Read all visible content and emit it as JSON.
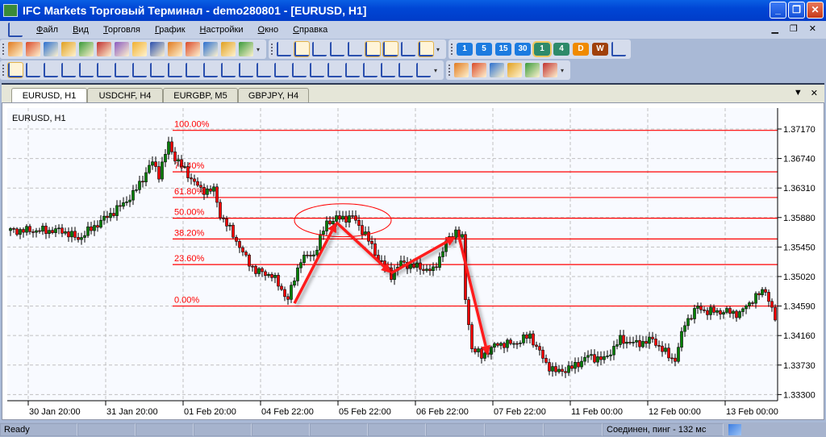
{
  "window": {
    "title": "IFC Markets Торговый Терминал - demo280801 - [EURUSD, H1]",
    "logo": "IFC"
  },
  "menu": [
    "Файл",
    "Вид",
    "Торговля",
    "График",
    "Настройки",
    "Окно",
    "Справка"
  ],
  "toolbar1": {
    "standard": [
      "new-order",
      "open-chart",
      "market-watch",
      "navigator",
      "terminal",
      "data-window",
      "expert-advisors",
      "strategy-tester",
      "history",
      "export",
      "alerts",
      "reports",
      "open-folder",
      "save-folder"
    ],
    "chart": [
      "bar-chart",
      "candlesticks",
      "line-chart",
      "zoom-in",
      "zoom-out",
      "auto-scroll",
      "chart-shift",
      "indicators",
      "grid"
    ],
    "timeframes": [
      {
        "label": "1",
        "color": "#1c7be0"
      },
      {
        "label": "5",
        "color": "#1c7be0"
      },
      {
        "label": "15",
        "color": "#1c7be0"
      },
      {
        "label": "30",
        "color": "#1c7be0"
      },
      {
        "label": "1",
        "color": "#2e8a6a",
        "active": true
      },
      {
        "label": "4",
        "color": "#2e8a6a"
      },
      {
        "label": "D",
        "color": "#f08a00"
      },
      {
        "label": "W",
        "color": "#a0400a"
      }
    ]
  },
  "toolbar2": {
    "drawing": [
      "cursor",
      "crosshair",
      "object",
      "trendline",
      "angle-line",
      "horizontal-line",
      "vertical-line",
      "pencil",
      "channel",
      "andrews-pitchfork",
      "gann-fan",
      "equidistant-channel",
      "fibo-retracement",
      "fibo-expansion",
      "fibo-arcs",
      "fibo-fan",
      "fibo-timezones",
      "fibo-channel",
      "regression",
      "rectangle",
      "triangle",
      "ellipse",
      "text",
      "text-label"
    ],
    "other": [
      "indicators-list",
      "alert-add",
      "alert-disabled",
      "options",
      "news",
      "help"
    ]
  },
  "tabs": [
    {
      "label": "EURUSD, H1",
      "active": true
    },
    {
      "label": "USDCHF, H4"
    },
    {
      "label": "EURGBP, M5"
    },
    {
      "label": "GBPJPY, H4"
    }
  ],
  "status": {
    "ready": "Ready",
    "connection": "Соединен, пинг - 132 мс"
  },
  "chart_data": {
    "type": "candlestick",
    "title": "EURUSD, H1",
    "ylim": [
      1.333,
      1.3717
    ],
    "y_ticks": [
      "1.37170",
      "1.36740",
      "1.36310",
      "1.35880",
      "1.35450",
      "1.35020",
      "1.34590",
      "1.34160",
      "1.33730",
      "1.33300"
    ],
    "x_ticks": [
      "30 Jan 20:00",
      "31 Jan 20:00",
      "01 Feb 20:00",
      "04 Feb 22:00",
      "05 Feb 22:00",
      "06 Feb 22:00",
      "07 Feb 22:00",
      "11 Feb 00:00",
      "12 Feb 00:00",
      "13 Feb 00:00"
    ],
    "bars": 238,
    "price_path": [
      [
        0,
        1.3569
      ],
      [
        17,
        1.3569
      ],
      [
        22,
        1.3557
      ],
      [
        30,
        1.3586
      ],
      [
        35,
        1.3604
      ],
      [
        39,
        1.3622
      ],
      [
        45,
        1.3669
      ],
      [
        47,
        1.3651
      ],
      [
        50,
        1.3695
      ],
      [
        52,
        1.3675
      ],
      [
        56,
        1.3651
      ],
      [
        60,
        1.3628
      ],
      [
        64,
        1.3628
      ],
      [
        66,
        1.3592
      ],
      [
        70,
        1.3563
      ],
      [
        74,
        1.3528
      ],
      [
        77,
        1.351
      ],
      [
        82,
        1.3504
      ],
      [
        87,
        1.3469
      ],
      [
        91,
        1.3528
      ],
      [
        95,
        1.3534
      ],
      [
        99,
        1.3581
      ],
      [
        102,
        1.3586
      ],
      [
        107,
        1.3589
      ],
      [
        111,
        1.3563
      ],
      [
        115,
        1.3528
      ],
      [
        119,
        1.3504
      ],
      [
        122,
        1.3522
      ],
      [
        127,
        1.3516
      ],
      [
        132,
        1.351
      ],
      [
        136,
        1.3551
      ],
      [
        139,
        1.3569
      ],
      [
        141,
        1.3557
      ],
      [
        142,
        1.3469
      ],
      [
        144,
        1.3398
      ],
      [
        147,
        1.3386
      ],
      [
        152,
        1.3404
      ],
      [
        157,
        1.3404
      ],
      [
        162,
        1.3416
      ],
      [
        167,
        1.3375
      ],
      [
        170,
        1.3363
      ],
      [
        175,
        1.3369
      ],
      [
        180,
        1.3386
      ],
      [
        185,
        1.3381
      ],
      [
        190,
        1.341
      ],
      [
        195,
        1.3404
      ],
      [
        200,
        1.341
      ],
      [
        205,
        1.3386
      ],
      [
        207,
        1.3381
      ],
      [
        210,
        1.3434
      ],
      [
        214,
        1.3457
      ],
      [
        217,
        1.3451
      ],
      [
        222,
        1.3451
      ],
      [
        227,
        1.3448
      ],
      [
        231,
        1.3469
      ],
      [
        235,
        1.3483
      ],
      [
        238,
        1.3439
      ]
    ],
    "fibo": {
      "high": 1.3715,
      "low": 1.3459,
      "levels": [
        {
          "label": "100.00%",
          "value": 1.0
        },
        {
          "label": "76.40%",
          "value": 0.764
        },
        {
          "label": "61.80%",
          "value": 0.618
        },
        {
          "label": "50.00%",
          "value": 0.5
        },
        {
          "label": "38.20%",
          "value": 0.382
        },
        {
          "label": "23.60%",
          "value": 0.236
        },
        {
          "label": "0.00%",
          "value": 0.0
        }
      ],
      "color": "#ff0000"
    },
    "arrows": [
      [
        [
          88,
          1.3463
        ],
        [
          101,
          1.3581
        ]
      ],
      [
        [
          101,
          1.3581
        ],
        [
          118,
          1.3507
        ]
      ],
      [
        [
          118,
          1.3507
        ],
        [
          138,
          1.356
        ]
      ],
      [
        [
          139,
          1.356
        ],
        [
          148,
          1.3387
        ]
      ]
    ],
    "ellipse": {
      "center": [
        103,
        1.3584
      ],
      "bars_radius": 15,
      "price_radius": 0.0024
    },
    "colors": {
      "up": "#008000",
      "down": "#ff0000",
      "wick": "#000000",
      "grid": "#c0c0c0"
    }
  }
}
